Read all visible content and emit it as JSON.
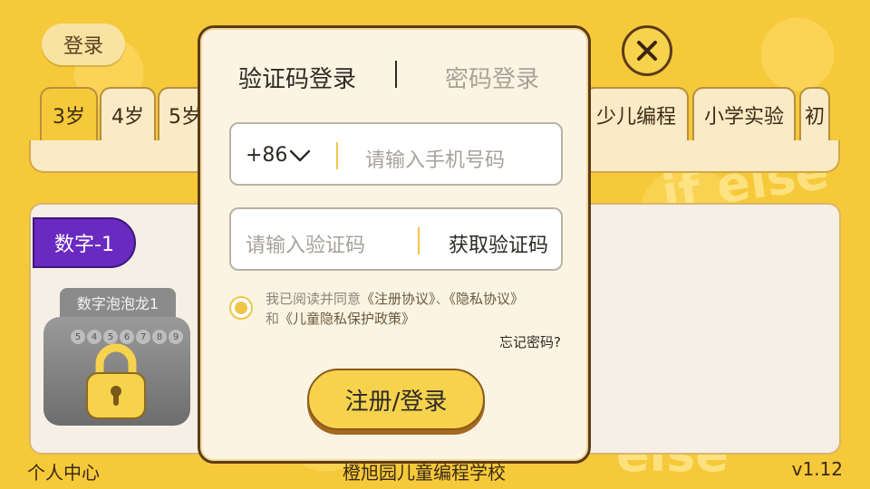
{
  "top_bar": {
    "login_label": "登录"
  },
  "age_tabs": [
    {
      "label": "3岁",
      "active": true
    },
    {
      "label": "4岁"
    },
    {
      "label": "5岁"
    },
    {
      "label": "少儿编程"
    },
    {
      "label": "小学实验"
    },
    {
      "label": "初"
    }
  ],
  "content": {
    "category_label": "数字-1",
    "lesson": {
      "title": "数字泡泡龙1",
      "locked": true,
      "numbers": [
        "5",
        "4",
        "5",
        "6",
        "7",
        "8",
        "9"
      ]
    }
  },
  "footer": {
    "left": "个人中心",
    "center": "橙旭园儿童编程学校",
    "version": "v1.12"
  },
  "dialog": {
    "tab_sms": "验证码登录",
    "tab_password": "密码登录",
    "country_code": "+86",
    "phone_placeholder": "请输入手机号码",
    "code_placeholder": "请输入验证码",
    "get_code_label": "获取验证码",
    "agree_prefix": "我已阅读并同意",
    "agree_link1": "《注册协议》",
    "agree_sep": "、",
    "agree_link2": "《隐私协议》",
    "agree_and": "和",
    "agree_link3": "《儿童隐私保护政策》",
    "forgot_label": "忘记密码?",
    "submit_label": "注册/登录"
  },
  "colors": {
    "background": "#f6c93a",
    "accent": "#f6d24d",
    "category": "#6a2ac1",
    "border_dark": "#5c3b17"
  },
  "icons": [
    "chevron-down-icon",
    "lock-icon",
    "close-icon",
    "radio-checked-icon"
  ]
}
